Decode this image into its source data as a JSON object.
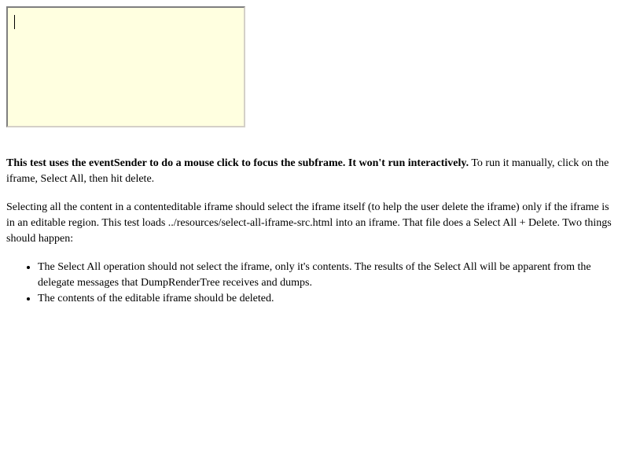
{
  "intro": {
    "bold_text": "This test uses the eventSender to do a mouse click to focus the subframe. It won't run interactively.",
    "normal_text": " To run it manually, click on the iframe, Select All, then hit delete."
  },
  "description": "Selecting all the content in a contenteditable iframe should select the iframe itself (to help the user delete the iframe) only if the iframe is in an editable region. This test loads ../resources/select-all-iframe-src.html into an iframe. That file does a Select All + Delete. Two things should happen:",
  "expectations": [
    "The Select All operation should not select the iframe, only it's contents. The results of the Select All will be apparent from the delegate messages that DumpRenderTree receives and dumps.",
    "The contents of the editable iframe should be deleted."
  ],
  "colors": {
    "iframe_background": "#ffffe0"
  }
}
